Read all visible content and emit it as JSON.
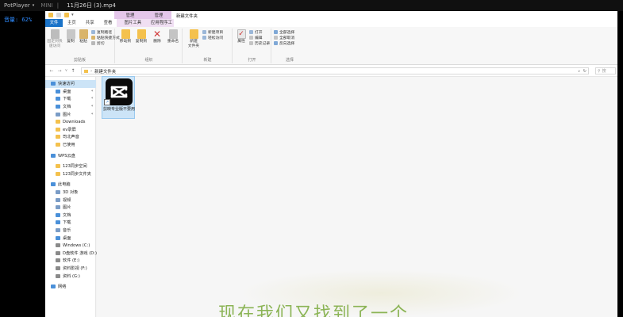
{
  "player": {
    "name": "PotPlayer",
    "mini_label": "MINI",
    "filename": "11月26日 (3).mp4",
    "volume_text": "音量: 62%"
  },
  "explorer": {
    "window_title": "新建文件夹",
    "context_tabs": [
      "管理",
      "管理"
    ],
    "ribbon_tabs": [
      "文件",
      "主页",
      "共享",
      "查看",
      "图片工具",
      "应用程序工具"
    ],
    "ribbon": {
      "pin_quick": "固定到快\n速访问",
      "copy": "复制",
      "paste": "粘贴",
      "copy_path": "复制路径",
      "paste_shortcut": "粘贴快捷方式",
      "cut": "剪切",
      "group_clipboard": "剪贴板",
      "move_to": "移动到",
      "copy_to": "复制到",
      "delete": "删除",
      "rename": "重命名",
      "group_organize": "组织",
      "new_folder": "新建\n文件夹",
      "new_item": "新建项目",
      "easy_access": "轻松访问",
      "group_new": "新建",
      "properties": "属性",
      "open": "打开",
      "edit": "编辑",
      "history": "历史记录",
      "group_open": "打开",
      "select_all": "全部选择",
      "select_none": "全部取消",
      "invert": "反向选择",
      "group_select": "选择"
    },
    "address": {
      "path": "新建文件夹",
      "search_placeholder": "搜"
    },
    "nav": [
      {
        "label": "快速访问",
        "selected": true
      },
      {
        "label": "桌面",
        "pinned": true
      },
      {
        "label": "下载",
        "pinned": true
      },
      {
        "label": "文档",
        "pinned": true
      },
      {
        "label": "图片",
        "pinned": true
      },
      {
        "label": "Downloads"
      },
      {
        "label": "ev录屏"
      },
      {
        "label": "司北声音"
      },
      {
        "label": "已使用"
      },
      {
        "label": "WPS云盘"
      },
      {
        "label": "123同步空间"
      },
      {
        "label": "123同步文件夹"
      },
      {
        "label": "此电脑"
      },
      {
        "label": "3D 对象"
      },
      {
        "label": "视频"
      },
      {
        "label": "图片"
      },
      {
        "label": "文档"
      },
      {
        "label": "下载"
      },
      {
        "label": "音乐"
      },
      {
        "label": "桌面"
      },
      {
        "label": "Windows (C:)"
      },
      {
        "label": "D盘软件 游戏 (D:)"
      },
      {
        "label": "软件 (E:)"
      },
      {
        "label": "资料影视 (F:)"
      },
      {
        "label": "资料 (G:)"
      },
      {
        "label": "网络"
      }
    ],
    "file": {
      "name": "剪映专业版不要用",
      "icon": "capcut-icon"
    }
  },
  "video_subtitle": "现在我们又找到了一个",
  "colors": {
    "volume_blue": "#2e8bff",
    "file_tab_blue": "#1a73c8",
    "selection": "#cce4f7",
    "subtitle_green": "#79a93a"
  }
}
